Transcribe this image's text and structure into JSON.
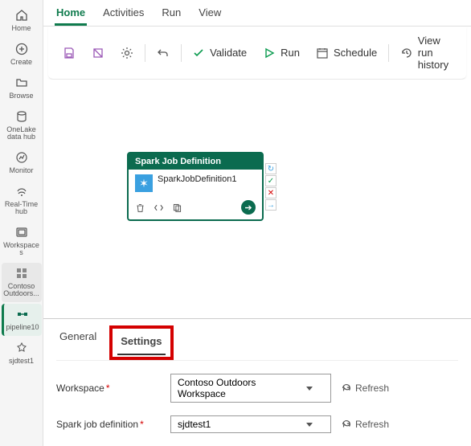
{
  "sidebar": {
    "items": [
      {
        "label": "Home"
      },
      {
        "label": "Create"
      },
      {
        "label": "Browse"
      },
      {
        "label": "OneLake data hub"
      },
      {
        "label": "Monitor"
      },
      {
        "label": "Real-Time hub"
      },
      {
        "label": "Workspaces"
      },
      {
        "label": "Contoso Outdoors..."
      },
      {
        "label": "pipeline10"
      },
      {
        "label": "sjdtest1"
      }
    ]
  },
  "topTabs": {
    "items": [
      {
        "label": "Home"
      },
      {
        "label": "Activities"
      },
      {
        "label": "Run"
      },
      {
        "label": "View"
      }
    ]
  },
  "toolbar": {
    "validate": "Validate",
    "run": "Run",
    "schedule": "Schedule",
    "history": "View run history"
  },
  "node": {
    "header": "Spark Job Definition",
    "title": "SparkJobDefinition1"
  },
  "panel": {
    "tabs": [
      {
        "label": "General"
      },
      {
        "label": "Settings"
      }
    ],
    "workspace_label": "Workspace",
    "workspace_value": "Contoso Outdoors Workspace",
    "sjd_label": "Spark job definition",
    "sjd_value": "sjdtest1",
    "refresh": "Refresh"
  }
}
